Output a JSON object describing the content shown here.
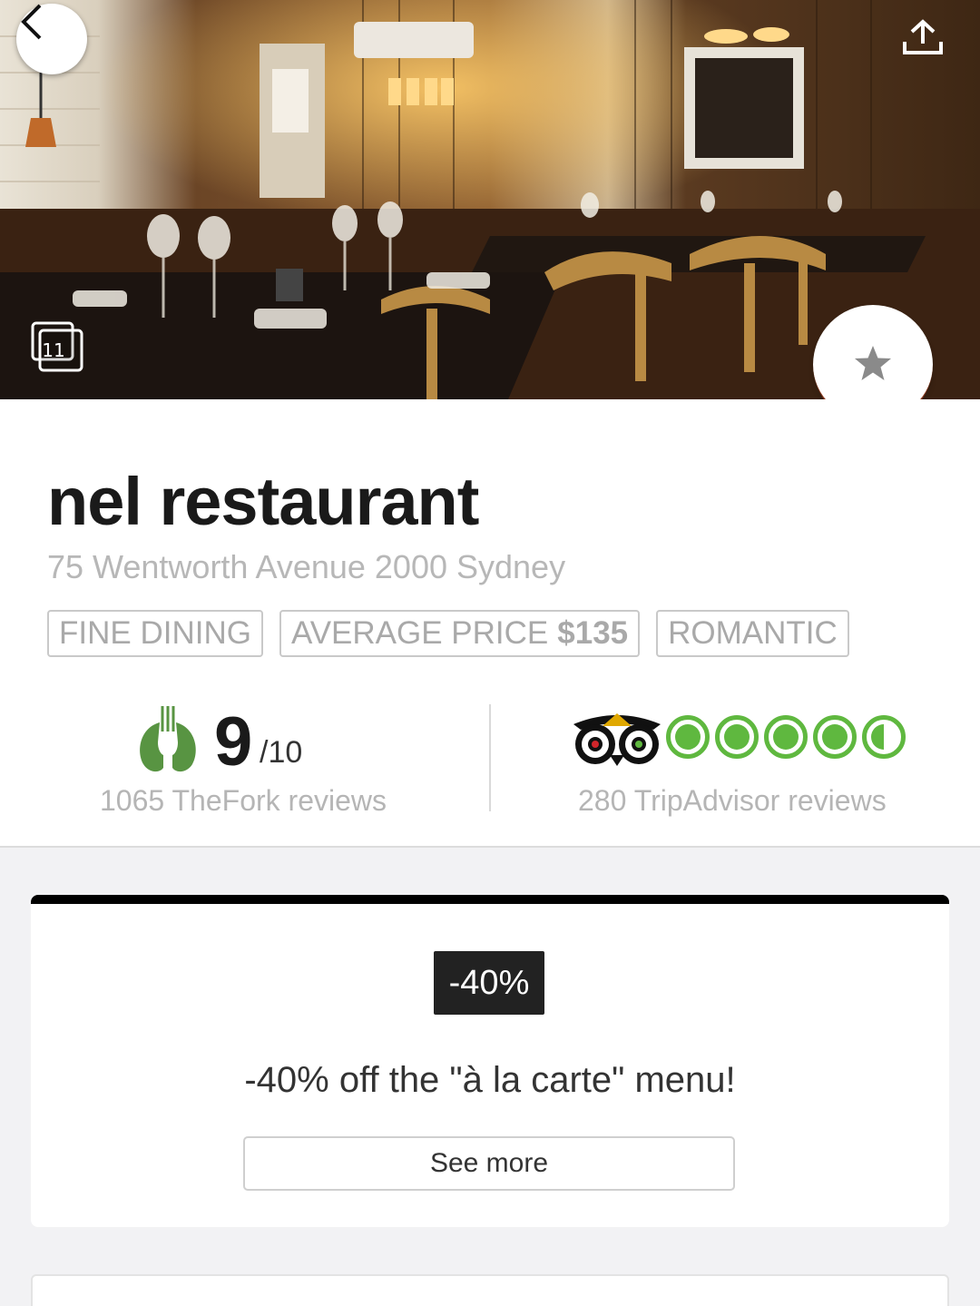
{
  "hero": {
    "gallery_count": "11",
    "back_icon": "chevron-left-icon",
    "share_icon": "share-upload-icon",
    "gallery_icon": "photo-stack-icon",
    "favorite_icon": "star-icon"
  },
  "restaurant": {
    "name": "nel restaurant",
    "address": "75 Wentworth Avenue 2000 Sydney",
    "tags": {
      "cuisine": "FINE DINING",
      "avg_price_label": "AVERAGE PRICE",
      "avg_price_value": "$135",
      "ambience": "ROMANTIC"
    }
  },
  "ratings": {
    "thefork": {
      "score": "9",
      "max": "/10",
      "reviews": "1065 TheFork reviews",
      "color": "#589442"
    },
    "tripadvisor": {
      "bubbles": 4.5,
      "reviews": "280 TripAdvisor reviews",
      "color": "#5fb83f"
    }
  },
  "offer": {
    "badge": "-40%",
    "description": "-40% off the \"à la carte\" menu!",
    "button_label": "See more"
  }
}
